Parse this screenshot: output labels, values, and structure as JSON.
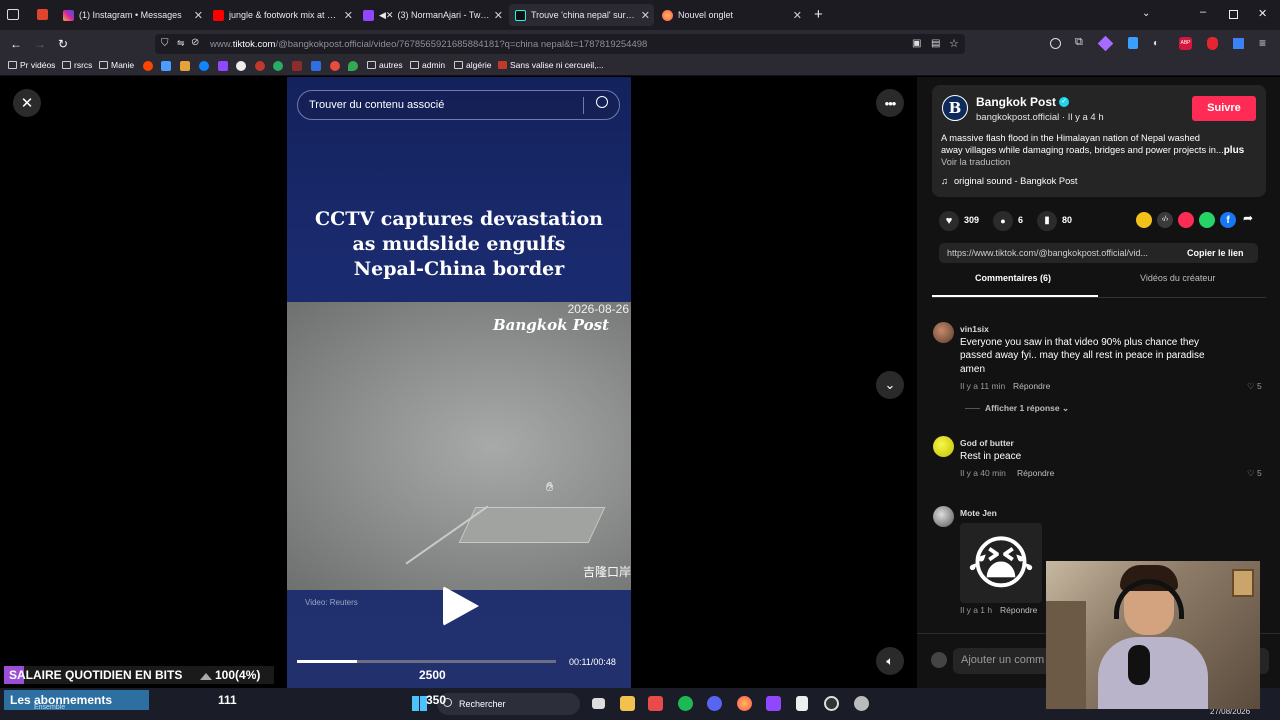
{
  "browser": {
    "tabs": [
      {
        "label": "(1) Instagram • Messages",
        "active": false
      },
      {
        "label": "jungle & footwork mix at a Tab",
        "active": false
      },
      {
        "label": "(3) NormanAjari - Twitch",
        "active": false
      },
      {
        "label": "Trouve 'china nepal' sur TikTok |",
        "active": true
      },
      {
        "label": "Nouvel onglet",
        "active": false
      }
    ],
    "url_prefix": "www.",
    "url_host": "tiktok.com",
    "url_path": "/@bangkokpost.official/video/7678565921685884181?q=china nepal&t=1787819254498",
    "bookmarks": [
      {
        "label": "Pr vidéos"
      },
      {
        "label": "rsrcs"
      },
      {
        "label": "Manie"
      },
      {
        "label": "autres"
      },
      {
        "label": "admin"
      },
      {
        "label": "algérie"
      },
      {
        "label": "Sans valise ni cercueil,..."
      }
    ]
  },
  "video": {
    "search_placeholder": "Trouver du contenu associé",
    "headline": [
      "CCTV captures devastation",
      "as mudslide engulfs",
      "Nepal-China border"
    ],
    "footage_date": "2026-08-26",
    "footage_logo": "Bangkok Post",
    "footage_caption": "吉隆口岸",
    "credit": "Video: Reuters",
    "progress": 0.23,
    "timecode": "00:11/00:48"
  },
  "post": {
    "author": "Bangkok Post",
    "handle": "bangkokpost.official",
    "separator": " · ",
    "time": "Il y a 4 h",
    "follow_label": "Suivre",
    "description_line1": "A massive flash flood in the Himalayan nation of Nepal washed",
    "description_line2": "away villages while damaging roads, bridges and power projects in...",
    "more_label": "plus",
    "translate_label": "Voir la traduction",
    "sound": "original sound - Bangkok Post",
    "likes": "309",
    "comments": "6",
    "saves": "80",
    "link_text": "https://www.tiktok.com/@bangkokpost.official/vid...",
    "copy_label": "Copier le lien",
    "tab_comments": "Commentaires (6)",
    "tab_creator": "Vidéos du créateur"
  },
  "comments": [
    {
      "user": "vin1six",
      "text_lines": [
        "Everyone you saw in that video 90% plus chance they",
        "passed away fyi.. may they all rest in peace in paradise",
        "amen"
      ],
      "time": "Il y a 11 min",
      "reply_label": "Répondre",
      "likes": "5",
      "replies_label": "Afficher 1 réponse"
    },
    {
      "user": "God of butter",
      "text_lines": [
        "Rest in peace"
      ],
      "time": "Il y a 40 min",
      "reply_label": "Répondre",
      "likes": "5"
    },
    {
      "user": "Mote Jen",
      "emoji": "😭",
      "time": "Il y a 1 h",
      "reply_label": "Répondre"
    }
  ],
  "comment_input_placeholder": "Ajouter un comm",
  "stream_overlay": {
    "goal_label": "SALAIRE QUOTIDIEN EN BITS",
    "goal_value": "100(4%)",
    "goal_target": "2500",
    "subs_label": "Les abonnements",
    "subs_sub": "Ensemble",
    "subs_value": "111",
    "subs_target": "350"
  },
  "taskbar": {
    "search_label": "Rechercher",
    "date": "27/08/2026"
  }
}
